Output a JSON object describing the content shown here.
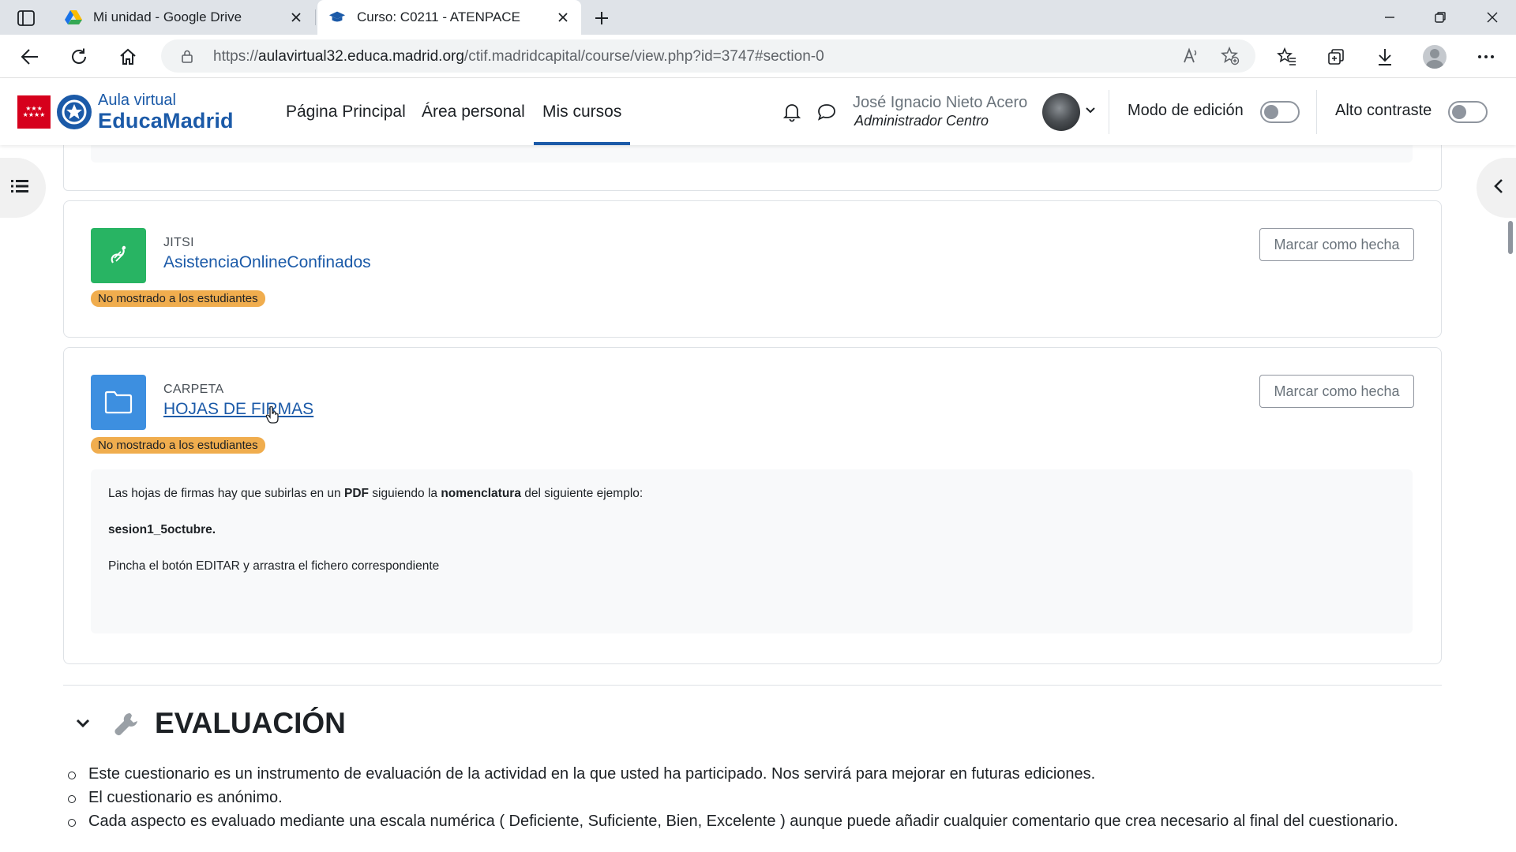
{
  "browser": {
    "tabs": [
      {
        "title": "Mi unidad - Google Drive",
        "active": false,
        "favicon": "google-drive-icon"
      },
      {
        "title": "Curso: C0211 - ATENPACE",
        "active": true,
        "favicon": "graduation-cap-icon"
      }
    ],
    "url": {
      "prefix": "https://",
      "host": "aulavirtual32.educa.madrid.org",
      "path": "/ctif.madridcapital/course/view.php?id=3747#section-0"
    }
  },
  "header": {
    "logo_line1": "Aula virtual",
    "logo_line2": "EducaMadrid",
    "nav": [
      {
        "label": "Página Principal"
      },
      {
        "label": "Área personal"
      },
      {
        "label": "Mis cursos",
        "active": true
      }
    ],
    "user_name": "José Ignacio Nieto Acero",
    "user_role": "Administrador Centro",
    "edit_mode_label": "Modo de edición",
    "edit_mode_on": false,
    "high_contrast_label": "Alto contraste",
    "high_contrast_on": false
  },
  "activities": [
    {
      "type": "JITSI",
      "name": "AsistenciaOnlineConfinados",
      "badge": "No mostrado a los estudiantes",
      "button": "Marcar como hecha",
      "icon": "jitsi-icon",
      "icon_color": "#28b463"
    },
    {
      "type": "CARPETA",
      "name": "HOJAS DE FIRMAS",
      "badge": "No mostrado a los estudiantes",
      "button": "Marcar como hecha",
      "icon": "folder-icon",
      "icon_color": "#3d8fe0",
      "description": {
        "line1": {
          "t1": "Las hojas de firmas hay que subirlas en un ",
          "b1": "PDF",
          "t2": " siguiendo la ",
          "b2": "nomenclatura",
          "t3": " del siguiente ejemplo:"
        },
        "line2": "sesion1_5octubre.",
        "line3": "Pincha el botón EDITAR y arrastra el fichero correspondiente"
      }
    }
  ],
  "section": {
    "title": "EVALUACIÓN",
    "icon": "wrench-icon",
    "items": [
      "Este cuestionario es un instrumento de evaluación de la actividad en la que usted ha participado. Nos servirá para mejorar en futuras ediciones.",
      "El cuestionario es anónimo.",
      "Cada aspecto es evaluado mediante una escala numérica ( Deficiente, Suficiente, Bien, Excelente ) aunque puede añadir cualquier comentario que crea necesario al final del cuestionario."
    ]
  },
  "colors": {
    "brand_blue": "#1b5aa8",
    "badge_orange": "#f0ad4e",
    "madrid_red": "#d6001c"
  }
}
